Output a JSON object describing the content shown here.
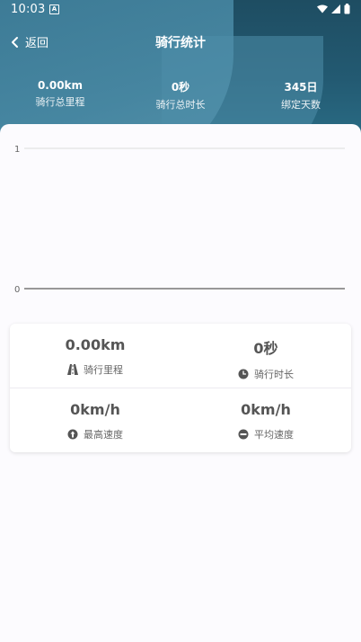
{
  "status_bar": {
    "time": "10:03",
    "notification_icon": "a-notification-icon",
    "wifi_icon": "wifi-icon",
    "signal_icon": "signal-icon",
    "battery_icon": "battery-icon"
  },
  "header": {
    "back_label": "返回",
    "title": "骑行统计"
  },
  "summary": [
    {
      "value": "0.00km",
      "label": "骑行总里程"
    },
    {
      "value": "0秒",
      "label": "骑行总时长"
    },
    {
      "value": "345日",
      "label": "绑定天数"
    }
  ],
  "chart_data": {
    "type": "line",
    "categories": [],
    "series": [
      {
        "values": []
      }
    ],
    "ylim": [
      0,
      1
    ],
    "yticks": [
      "1",
      "0"
    ],
    "grid": true
  },
  "stats": {
    "distance": {
      "value": "0.00km",
      "label": "骑行里程",
      "icon": "road-icon"
    },
    "duration": {
      "value": "0秒",
      "label": "骑行时长",
      "icon": "clock-icon"
    },
    "max_speed": {
      "value": "0km/h",
      "label": "最高速度",
      "icon": "max-speed-icon"
    },
    "avg_speed": {
      "value": "0km/h",
      "label": "平均速度",
      "icon": "avg-speed-icon"
    }
  },
  "colors": {
    "header_dark": "#1e4d62",
    "header_light": "#4a8aa5",
    "background": "#f7f5fa",
    "axis_line": "#333333",
    "grid_line": "#dcdcdc"
  }
}
